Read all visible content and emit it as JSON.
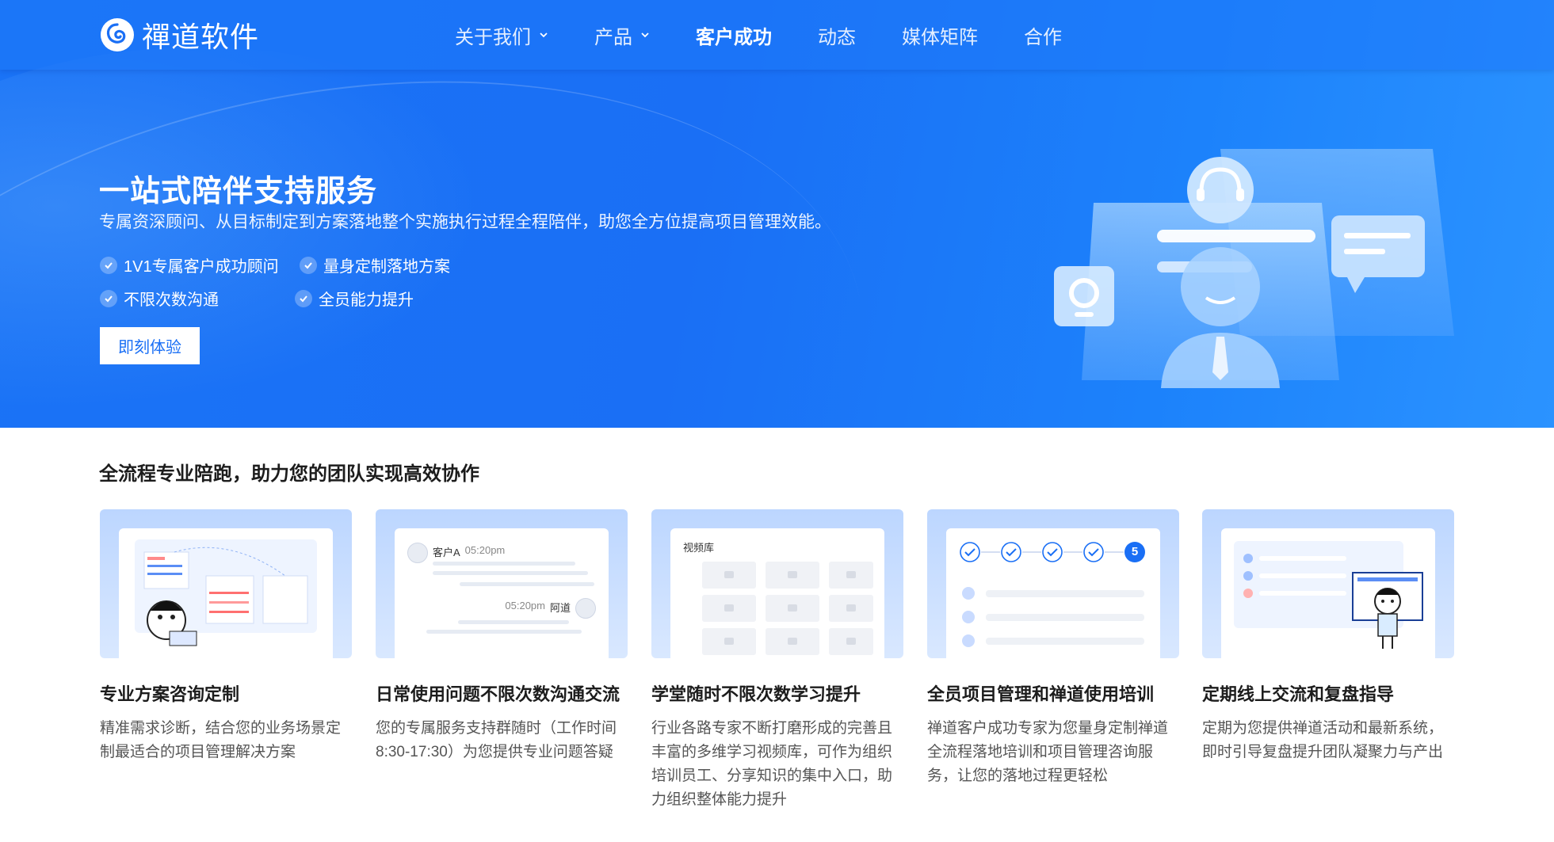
{
  "brand": {
    "name": "禪道软件"
  },
  "nav": {
    "items": [
      {
        "label": "关于我们",
        "dropdown": true
      },
      {
        "label": "产品",
        "dropdown": true
      },
      {
        "label": "客户成功",
        "active": true
      },
      {
        "label": "动态"
      },
      {
        "label": "媒体矩阵"
      },
      {
        "label": "合作"
      }
    ]
  },
  "hero": {
    "title": "一站式陪伴支持服务",
    "subtitle": "专属资深顾问、从目标制定到方案落地整个实施执行过程全程陪伴，助您全方位提高项目管理效能。",
    "features": [
      "1V1专属客户成功顾问",
      "量身定制落地方案",
      "不限次数沟通",
      "全员能力提升"
    ],
    "cta_label": "即刻体验"
  },
  "section": {
    "title": "全流程专业陪跑，助力您的团队实现高效协作",
    "cards": [
      {
        "title": "专业方案咨询定制",
        "desc": "精准需求诊断，结合您的业务场景定制最适合的项目管理解决方案"
      },
      {
        "title": "日常使用问题不限次数沟通交流",
        "desc": "您的专属服务支持群随时（工作时间8:30-17:30）为您提供专业问题答疑",
        "chat": {
          "user_a": "客户A",
          "time_a": "05:20pm",
          "user_b": "阿道",
          "time_b": "05:20pm"
        }
      },
      {
        "title": "学堂随时不限次数学习提升",
        "desc": "行业各路专家不断打磨形成的完善且丰富的多维学习视频库，可作为组织培训员工、分享知识的集中入口，助力组织整体能力提升",
        "panel_label": "视频库"
      },
      {
        "title": "全员项目管理和禅道使用培训",
        "desc": "禅道客户成功专家为您量身定制禅道全流程落地培训和项目管理咨询服务，让您的落地过程更轻松",
        "step_number": "5"
      },
      {
        "title": "定期线上交流和复盘指导",
        "desc": "定期为您提供禅道活动和最新系统，即时引导复盘提升团队凝聚力与产出"
      }
    ]
  },
  "colors": {
    "primary": "#1a6ff5",
    "white": "#ffffff",
    "text_dark": "#1c1c1c",
    "text_muted": "#555555"
  }
}
